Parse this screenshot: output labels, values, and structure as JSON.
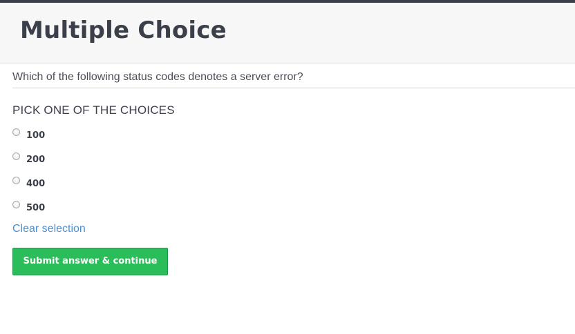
{
  "header": {
    "title": "Multiple Choice"
  },
  "question": {
    "text": "Which of the following status codes denotes a server error?"
  },
  "instructions": {
    "text": "PICK ONE OF THE CHOICES"
  },
  "choices": [
    {
      "label": "100",
      "selected": false
    },
    {
      "label": "200",
      "selected": false
    },
    {
      "label": "400",
      "selected": false
    },
    {
      "label": "500",
      "selected": false
    }
  ],
  "actions": {
    "clear_label": "Clear selection",
    "submit_label": "Submit answer & continue"
  },
  "colors": {
    "top_strip": "#3a3e48",
    "header_bg": "#f7f7f7",
    "link": "#4a90d9",
    "submit_bg": "#2bbd5a"
  }
}
